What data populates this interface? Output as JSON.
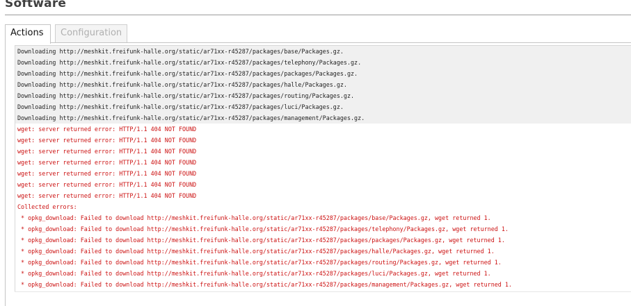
{
  "page": {
    "title": "Software"
  },
  "tabs": [
    {
      "label": "Actions",
      "active": true
    },
    {
      "label": "Configuration",
      "active": false
    }
  ],
  "log": {
    "lines": [
      {
        "type": "ok",
        "text": "Downloading http://meshkit.freifunk-halle.org/static/ar71xx-r45287/packages/base/Packages.gz."
      },
      {
        "type": "ok",
        "text": "Downloading http://meshkit.freifunk-halle.org/static/ar71xx-r45287/packages/telephony/Packages.gz."
      },
      {
        "type": "ok",
        "text": "Downloading http://meshkit.freifunk-halle.org/static/ar71xx-r45287/packages/packages/Packages.gz."
      },
      {
        "type": "ok",
        "text": "Downloading http://meshkit.freifunk-halle.org/static/ar71xx-r45287/packages/halle/Packages.gz."
      },
      {
        "type": "ok",
        "text": "Downloading http://meshkit.freifunk-halle.org/static/ar71xx-r45287/packages/routing/Packages.gz."
      },
      {
        "type": "ok",
        "text": "Downloading http://meshkit.freifunk-halle.org/static/ar71xx-r45287/packages/luci/Packages.gz."
      },
      {
        "type": "ok",
        "text": "Downloading http://meshkit.freifunk-halle.org/static/ar71xx-r45287/packages/management/Packages.gz."
      },
      {
        "type": "err",
        "text": "wget: server returned error: HTTP/1.1 404 NOT FOUND"
      },
      {
        "type": "err",
        "text": "wget: server returned error: HTTP/1.1 404 NOT FOUND"
      },
      {
        "type": "err",
        "text": "wget: server returned error: HTTP/1.1 404 NOT FOUND"
      },
      {
        "type": "err",
        "text": "wget: server returned error: HTTP/1.1 404 NOT FOUND"
      },
      {
        "type": "err",
        "text": "wget: server returned error: HTTP/1.1 404 NOT FOUND"
      },
      {
        "type": "err",
        "text": "wget: server returned error: HTTP/1.1 404 NOT FOUND"
      },
      {
        "type": "err",
        "text": "wget: server returned error: HTTP/1.1 404 NOT FOUND"
      },
      {
        "type": "err",
        "text": "Collected errors:"
      },
      {
        "type": "err",
        "text": " * opkg_download: Failed to download http://meshkit.freifunk-halle.org/static/ar71xx-r45287/packages/base/Packages.gz, wget returned 1."
      },
      {
        "type": "err",
        "text": " * opkg_download: Failed to download http://meshkit.freifunk-halle.org/static/ar71xx-r45287/packages/telephony/Packages.gz, wget returned 1."
      },
      {
        "type": "err",
        "text": " * opkg_download: Failed to download http://meshkit.freifunk-halle.org/static/ar71xx-r45287/packages/packages/Packages.gz, wget returned 1."
      },
      {
        "type": "err",
        "text": " * opkg_download: Failed to download http://meshkit.freifunk-halle.org/static/ar71xx-r45287/packages/halle/Packages.gz, wget returned 1."
      },
      {
        "type": "err",
        "text": " * opkg_download: Failed to download http://meshkit.freifunk-halle.org/static/ar71xx-r45287/packages/routing/Packages.gz, wget returned 1."
      },
      {
        "type": "err",
        "text": " * opkg_download: Failed to download http://meshkit.freifunk-halle.org/static/ar71xx-r45287/packages/luci/Packages.gz, wget returned 1."
      },
      {
        "type": "err",
        "text": " * opkg_download: Failed to download http://meshkit.freifunk-halle.org/static/ar71xx-r45287/packages/management/Packages.gz, wget returned 1."
      }
    ]
  },
  "colors": {
    "ok_text": "#222222",
    "ok_background": "#f0f0f0",
    "error_text": "#cc1111",
    "inactive_tab_text": "#b0b0b0"
  }
}
